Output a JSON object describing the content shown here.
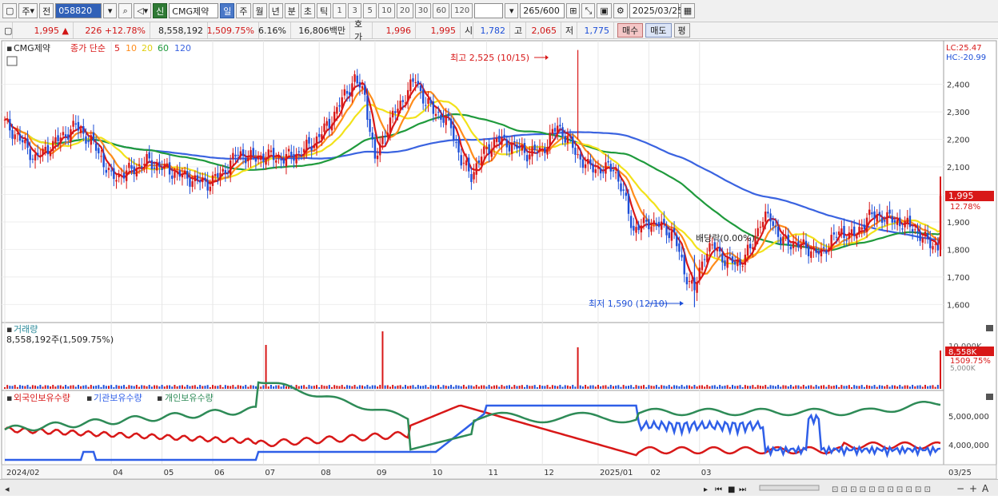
{
  "toolbar": {
    "period_type": "주",
    "prev_label": "전",
    "stock_code": "058820",
    "market_badge": "신",
    "stock_name": "CMG제약",
    "periods": [
      "일",
      "주",
      "월",
      "년",
      "분",
      "초",
      "틱"
    ],
    "selected_period": "일",
    "intervals": [
      "1",
      "3",
      "5",
      "10",
      "20",
      "30",
      "60",
      "120"
    ],
    "count_display": "265",
    "count_max": "/600",
    "date": "2025/03/25"
  },
  "quote": {
    "price": "1,995",
    "change": "226",
    "change_pct": "+12.78%",
    "volume": "8,558,192",
    "volume_pct": "1,509.75%",
    "turnover_pct": "6.16%",
    "amount": "16,806",
    "amount_unit": "백만",
    "hoga_label": "호가",
    "bid": "1,996",
    "ask": "1,995",
    "open_label": "시",
    "open": "1,782",
    "high_label": "고",
    "high": "2,065",
    "low_label": "저",
    "low": "1,775",
    "buy_label": "매수",
    "sell_label": "매도",
    "flat_label": "평"
  },
  "legend": {
    "name": "CMG제약",
    "ma_label": "종가 단순",
    "ma_periods": [
      "5",
      "10",
      "20",
      "60",
      "120"
    ],
    "ma_colors": [
      "#d81818",
      "#ff8c1a",
      "#f2e21a",
      "#1f9a3c",
      "#3a63e0"
    ],
    "lc": "LC:25.47",
    "hc": "HC:-20.99"
  },
  "annotations": {
    "high": "최고 2,525 (10/15)",
    "low": "최저 1,590 (12/10)",
    "dividend": "배당락(0.00%)"
  },
  "price_tag": {
    "value": "1,995",
    "pct": "12.78%"
  },
  "volume_panel": {
    "title": "거래량",
    "subtitle": "8,558,192주(1,509.75%)",
    "axis_label": "10,000K",
    "tag_value": "8,558K",
    "tag_pct": "1509.75%",
    "axis_sub": "5,000K"
  },
  "holding_panel": {
    "labels": [
      "외국인보유수량",
      "기관보유수량",
      "개인보유수량"
    ],
    "colors": [
      "#d81818",
      "#2f5fe8",
      "#2e8b57"
    ],
    "yticks": [
      "5,000,000",
      "4,000,000"
    ]
  },
  "chart_data": {
    "type": "candlestick",
    "x_axis": [
      "2024/02",
      "04",
      "05",
      "06",
      "07",
      "08",
      "09",
      "10",
      "11",
      "12",
      "2025/01",
      "02",
      "03",
      "03/25"
    ],
    "y_ticks": [
      2400,
      2300,
      2200,
      2100,
      2000,
      1900,
      1800,
      1700,
      1600
    ],
    "ylim": [
      1540,
      2550
    ],
    "anchors": [
      [
        0,
        2260
      ],
      [
        6,
        2200
      ],
      [
        12,
        2130
      ],
      [
        16,
        2160
      ],
      [
        20,
        2190
      ],
      [
        28,
        2250
      ],
      [
        36,
        2170
      ],
      [
        42,
        2060
      ],
      [
        48,
        2080
      ],
      [
        56,
        2120
      ],
      [
        64,
        2090
      ],
      [
        72,
        2060
      ],
      [
        80,
        2040
      ],
      [
        86,
        2080
      ],
      [
        92,
        2150
      ],
      [
        98,
        2130
      ],
      [
        104,
        2140
      ],
      [
        110,
        2130
      ],
      [
        116,
        2150
      ],
      [
        122,
        2190
      ],
      [
        128,
        2260
      ],
      [
        134,
        2360
      ],
      [
        138,
        2420
      ],
      [
        142,
        2360
      ],
      [
        146,
        2120
      ],
      [
        150,
        2230
      ],
      [
        154,
        2300
      ],
      [
        158,
        2360
      ],
      [
        162,
        2420
      ],
      [
        166,
        2330
      ],
      [
        170,
        2300
      ],
      [
        176,
        2250
      ],
      [
        180,
        2120
      ],
      [
        184,
        2070
      ],
      [
        188,
        2140
      ],
      [
        194,
        2200
      ],
      [
        200,
        2180
      ],
      [
        206,
        2150
      ],
      [
        212,
        2160
      ],
      [
        218,
        2250
      ],
      [
        222,
        2200
      ],
      [
        226,
        2140
      ],
      [
        230,
        2100
      ],
      [
        236,
        2090
      ],
      [
        240,
        2100
      ],
      [
        244,
        2000
      ],
      [
        248,
        1870
      ],
      [
        254,
        1900
      ],
      [
        260,
        1880
      ],
      [
        264,
        1850
      ],
      [
        268,
        1720
      ],
      [
        272,
        1650
      ],
      [
        276,
        1790
      ],
      [
        280,
        1810
      ],
      [
        284,
        1760
      ],
      [
        290,
        1750
      ],
      [
        294,
        1800
      ],
      [
        298,
        1900
      ],
      [
        302,
        1920
      ],
      [
        306,
        1830
      ],
      [
        312,
        1820
      ],
      [
        318,
        1800
      ],
      [
        322,
        1780
      ],
      [
        326,
        1840
      ],
      [
        330,
        1860
      ],
      [
        336,
        1850
      ],
      [
        340,
        1920
      ],
      [
        346,
        1920
      ],
      [
        352,
        1900
      ],
      [
        358,
        1880
      ],
      [
        362,
        1840
      ],
      [
        366,
        1820
      ],
      [
        369,
        1800
      ]
    ],
    "annotated_points": {
      "high": 2525,
      "high_date": "10/15",
      "low": 1590,
      "low_date": "12/10",
      "last_close": 1995
    }
  }
}
